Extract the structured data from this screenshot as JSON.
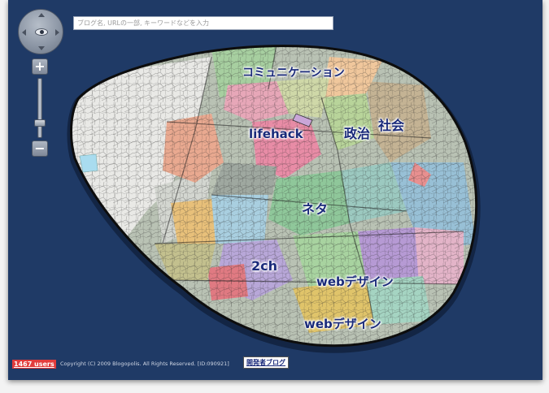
{
  "search": {
    "placeholder": "ブログ名, URLの一部, キーワードなどを入力"
  },
  "map": {
    "background_color": "#1f3a66",
    "labels": [
      {
        "id": "communication",
        "text": "コミュニケーション"
      },
      {
        "id": "lifehack",
        "text": "lifehack"
      },
      {
        "id": "politics",
        "text": "政治"
      },
      {
        "id": "society",
        "text": "社会"
      },
      {
        "id": "neta",
        "text": "ネタ"
      },
      {
        "id": "2ch",
        "text": "2ch"
      },
      {
        "id": "webdesign-1",
        "text": "webデザイン"
      },
      {
        "id": "webdesign-2",
        "text": "webデザイン"
      }
    ]
  },
  "controls": {
    "compass_icon": "eye-icon",
    "zoom_in_label": "+",
    "zoom_out_label": "−"
  },
  "footer": {
    "users": "1467 users",
    "copyright": "Copyright (C) 2009 Blogopolis. All Rights Reserved. [ID:090921]",
    "dev_blog": "開発者ブログ",
    "users_badge_color": "#e23c3c"
  }
}
